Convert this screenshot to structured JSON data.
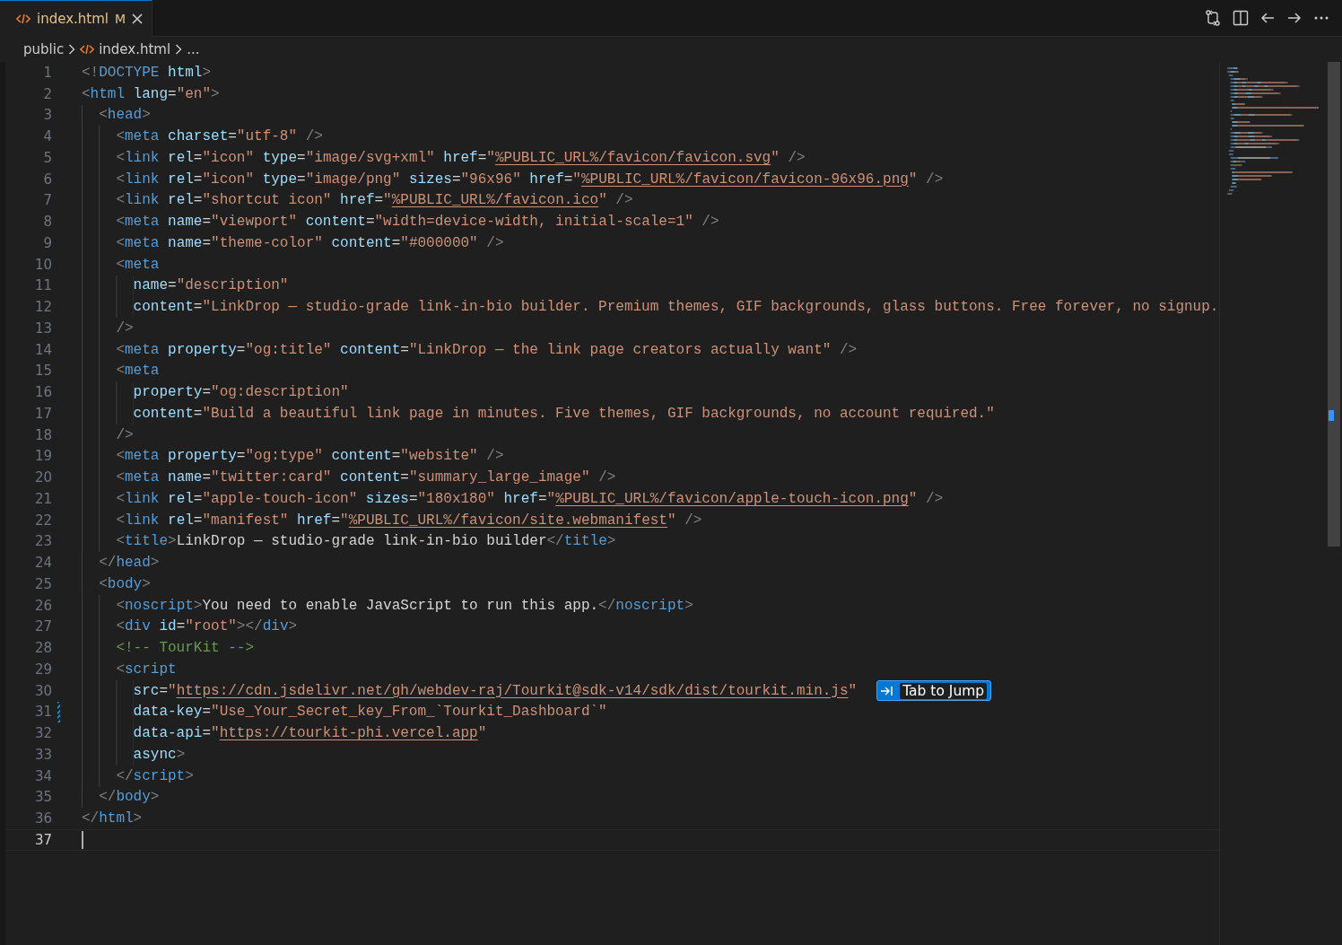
{
  "tabs": [
    {
      "label": "index.html",
      "badge": "M",
      "selected": true
    }
  ],
  "breadcrumbs": [
    "public",
    "index.html",
    "..."
  ],
  "lines": [
    {
      "number": "1",
      "tokens": [
        {
          "kind": "p",
          "text": "<!"
        },
        {
          "kind": "tag",
          "text": "DOCTYPE"
        },
        {
          "kind": "attr",
          "text": " html"
        },
        {
          "kind": "p",
          "text": ">"
        }
      ]
    },
    {
      "number": "2",
      "tokens": [
        {
          "kind": "p",
          "text": "<"
        },
        {
          "kind": "tag",
          "text": "html"
        },
        {
          "kind": "attr",
          "text": " lang"
        },
        {
          "kind": "eq",
          "text": "="
        },
        {
          "kind": "str",
          "text": "\"en\""
        },
        {
          "kind": "p",
          "text": ">"
        }
      ],
      "children": [
        {
          "number": "3",
          "tokens": [
            {
              "kind": "p",
              "text": "<"
            },
            {
              "kind": "tag",
              "text": "head"
            },
            {
              "kind": "p",
              "text": ">"
            }
          ],
          "children": [
            {
              "number": "4",
              "tokens": [
                {
                  "kind": "p",
                  "text": "<"
                },
                {
                  "kind": "tag",
                  "text": "meta"
                },
                {
                  "kind": "attr",
                  "text": " charset"
                },
                {
                  "kind": "eq",
                  "text": "="
                },
                {
                  "kind": "str",
                  "text": "\"utf-8\""
                },
                {
                  "kind": "p",
                  "text": " />"
                }
              ]
            },
            {
              "number": "5",
              "tokens": [
                {
                  "kind": "p",
                  "text": "<"
                },
                {
                  "kind": "tag",
                  "text": "link"
                },
                {
                  "kind": "attr",
                  "text": " rel"
                },
                {
                  "kind": "eq",
                  "text": "="
                },
                {
                  "kind": "str",
                  "text": "\"icon\""
                },
                {
                  "kind": "attr",
                  "text": " type"
                },
                {
                  "kind": "eq",
                  "text": "="
                },
                {
                  "kind": "str",
                  "text": "\"image/svg+xml\""
                },
                {
                  "kind": "attr",
                  "text": " href"
                },
                {
                  "kind": "eq",
                  "text": "="
                },
                {
                  "kind": "str",
                  "text": "\""
                },
                {
                  "kind": "url",
                  "text": "%PUBLIC_URL%/favicon/favicon.svg"
                },
                {
                  "kind": "str",
                  "text": "\""
                },
                {
                  "kind": "p",
                  "text": " />"
                }
              ]
            },
            {
              "number": "6",
              "tokens": [
                {
                  "kind": "p",
                  "text": "<"
                },
                {
                  "kind": "tag",
                  "text": "link"
                },
                {
                  "kind": "attr",
                  "text": " rel"
                },
                {
                  "kind": "eq",
                  "text": "="
                },
                {
                  "kind": "str",
                  "text": "\"icon\""
                },
                {
                  "kind": "attr",
                  "text": " type"
                },
                {
                  "kind": "eq",
                  "text": "="
                },
                {
                  "kind": "str",
                  "text": "\"image/png\""
                },
                {
                  "kind": "attr",
                  "text": " sizes"
                },
                {
                  "kind": "eq",
                  "text": "="
                },
                {
                  "kind": "str",
                  "text": "\"96x96\""
                },
                {
                  "kind": "attr",
                  "text": " href"
                },
                {
                  "kind": "eq",
                  "text": "="
                },
                {
                  "kind": "str",
                  "text": "\""
                },
                {
                  "kind": "url",
                  "text": "%PUBLIC_URL%/favicon/favicon-96x96.png"
                },
                {
                  "kind": "str",
                  "text": "\""
                },
                {
                  "kind": "p",
                  "text": " />"
                }
              ]
            },
            {
              "number": "7",
              "tokens": [
                {
                  "kind": "p",
                  "text": "<"
                },
                {
                  "kind": "tag",
                  "text": "link"
                },
                {
                  "kind": "attr",
                  "text": " rel"
                },
                {
                  "kind": "eq",
                  "text": "="
                },
                {
                  "kind": "str",
                  "text": "\"shortcut icon\""
                },
                {
                  "kind": "attr",
                  "text": " href"
                },
                {
                  "kind": "eq",
                  "text": "="
                },
                {
                  "kind": "str",
                  "text": "\""
                },
                {
                  "kind": "url",
                  "text": "%PUBLIC_URL%/favicon.ico"
                },
                {
                  "kind": "str",
                  "text": "\""
                },
                {
                  "kind": "p",
                  "text": " />"
                }
              ]
            },
            {
              "number": "8",
              "tokens": [
                {
                  "kind": "p",
                  "text": "<"
                },
                {
                  "kind": "tag",
                  "text": "meta"
                },
                {
                  "kind": "attr",
                  "text": " name"
                },
                {
                  "kind": "eq",
                  "text": "="
                },
                {
                  "kind": "str",
                  "text": "\"viewport\""
                },
                {
                  "kind": "attr",
                  "text": " content"
                },
                {
                  "kind": "eq",
                  "text": "="
                },
                {
                  "kind": "str",
                  "text": "\"width=device-width, initial-scale=1\""
                },
                {
                  "kind": "p",
                  "text": " />"
                }
              ]
            },
            {
              "number": "9",
              "tokens": [
                {
                  "kind": "p",
                  "text": "<"
                },
                {
                  "kind": "tag",
                  "text": "meta"
                },
                {
                  "kind": "attr",
                  "text": " name"
                },
                {
                  "kind": "eq",
                  "text": "="
                },
                {
                  "kind": "str",
                  "text": "\"theme-color\""
                },
                {
                  "kind": "attr",
                  "text": " content"
                },
                {
                  "kind": "eq",
                  "text": "="
                },
                {
                  "kind": "str",
                  "text": "\"#000000\""
                },
                {
                  "kind": "p",
                  "text": " />"
                }
              ]
            },
            {
              "number": "10",
              "tokens": [
                {
                  "kind": "p",
                  "text": "<"
                },
                {
                  "kind": "tag",
                  "text": "meta"
                }
              ],
              "children": [
                {
                  "number": "11",
                  "tokens": [
                    {
                      "kind": "attr",
                      "text": "name"
                    },
                    {
                      "kind": "eq",
                      "text": "="
                    },
                    {
                      "kind": "str",
                      "text": "\"description\""
                    }
                  ]
                },
                {
                  "number": "12",
                  "tokens": [
                    {
                      "kind": "attr",
                      "text": "content"
                    },
                    {
                      "kind": "eq",
                      "text": "="
                    },
                    {
                      "kind": "str",
                      "text": "\"LinkDrop — studio-grade link-in-bio builder. Premium themes, GIF backgrounds, glass buttons. Free forever, no signup."
                    }
                  ]
                }
              ]
            },
            {
              "number": "13",
              "tokens": [
                {
                  "kind": "p",
                  "text": "/>"
                }
              ]
            },
            {
              "number": "14",
              "tokens": [
                {
                  "kind": "p",
                  "text": "<"
                },
                {
                  "kind": "tag",
                  "text": "meta"
                },
                {
                  "kind": "attr",
                  "text": " property"
                },
                {
                  "kind": "eq",
                  "text": "="
                },
                {
                  "kind": "str",
                  "text": "\"og:title\""
                },
                {
                  "kind": "attr",
                  "text": " content"
                },
                {
                  "kind": "eq",
                  "text": "="
                },
                {
                  "kind": "str",
                  "text": "\"LinkDrop — the link page creators actually want\""
                },
                {
                  "kind": "p",
                  "text": " />"
                }
              ]
            },
            {
              "number": "15",
              "tokens": [
                {
                  "kind": "p",
                  "text": "<"
                },
                {
                  "kind": "tag",
                  "text": "meta"
                }
              ],
              "children": [
                {
                  "number": "16",
                  "tokens": [
                    {
                      "kind": "attr",
                      "text": "property"
                    },
                    {
                      "kind": "eq",
                      "text": "="
                    },
                    {
                      "kind": "str",
                      "text": "\"og:description\""
                    }
                  ]
                },
                {
                  "number": "17",
                  "tokens": [
                    {
                      "kind": "attr",
                      "text": "content"
                    },
                    {
                      "kind": "eq",
                      "text": "="
                    },
                    {
                      "kind": "str",
                      "text": "\"Build a beautiful link page in minutes. Five themes, GIF backgrounds, no account required.\""
                    }
                  ]
                }
              ]
            },
            {
              "number": "18",
              "tokens": [
                {
                  "kind": "p",
                  "text": "/>"
                }
              ]
            },
            {
              "number": "19",
              "tokens": [
                {
                  "kind": "p",
                  "text": "<"
                },
                {
                  "kind": "tag",
                  "text": "meta"
                },
                {
                  "kind": "attr",
                  "text": " property"
                },
                {
                  "kind": "eq",
                  "text": "="
                },
                {
                  "kind": "str",
                  "text": "\"og:type\""
                },
                {
                  "kind": "attr",
                  "text": " content"
                },
                {
                  "kind": "eq",
                  "text": "="
                },
                {
                  "kind": "str",
                  "text": "\"website\""
                },
                {
                  "kind": "p",
                  "text": " />"
                }
              ]
            },
            {
              "number": "20",
              "tokens": [
                {
                  "kind": "p",
                  "text": "<"
                },
                {
                  "kind": "tag",
                  "text": "meta"
                },
                {
                  "kind": "attr",
                  "text": " name"
                },
                {
                  "kind": "eq",
                  "text": "="
                },
                {
                  "kind": "str",
                  "text": "\"twitter:card\""
                },
                {
                  "kind": "attr",
                  "text": " content"
                },
                {
                  "kind": "eq",
                  "text": "="
                },
                {
                  "kind": "str",
                  "text": "\"summary_large_image\""
                },
                {
                  "kind": "p",
                  "text": " />"
                }
              ]
            },
            {
              "number": "21",
              "tokens": [
                {
                  "kind": "p",
                  "text": "<"
                },
                {
                  "kind": "tag",
                  "text": "link"
                },
                {
                  "kind": "attr",
                  "text": " rel"
                },
                {
                  "kind": "eq",
                  "text": "="
                },
                {
                  "kind": "str",
                  "text": "\"apple-touch-icon\""
                },
                {
                  "kind": "attr",
                  "text": " sizes"
                },
                {
                  "kind": "eq",
                  "text": "="
                },
                {
                  "kind": "str",
                  "text": "\"180x180\""
                },
                {
                  "kind": "attr",
                  "text": " href"
                },
                {
                  "kind": "eq",
                  "text": "="
                },
                {
                  "kind": "str",
                  "text": "\""
                },
                {
                  "kind": "url",
                  "text": "%PUBLIC_URL%/favicon/apple-touch-icon.png"
                },
                {
                  "kind": "str",
                  "text": "\""
                },
                {
                  "kind": "p",
                  "text": " />"
                }
              ]
            },
            {
              "number": "22",
              "tokens": [
                {
                  "kind": "p",
                  "text": "<"
                },
                {
                  "kind": "tag",
                  "text": "link"
                },
                {
                  "kind": "attr",
                  "text": " rel"
                },
                {
                  "kind": "eq",
                  "text": "="
                },
                {
                  "kind": "str",
                  "text": "\"manifest\""
                },
                {
                  "kind": "attr",
                  "text": " href"
                },
                {
                  "kind": "eq",
                  "text": "="
                },
                {
                  "kind": "str",
                  "text": "\""
                },
                {
                  "kind": "url",
                  "text": "%PUBLIC_URL%/favicon/site.webmanifest"
                },
                {
                  "kind": "str",
                  "text": "\""
                },
                {
                  "kind": "p",
                  "text": " />"
                }
              ]
            },
            {
              "number": "23",
              "tokens": [
                {
                  "kind": "p",
                  "text": "<"
                },
                {
                  "kind": "tag",
                  "text": "title"
                },
                {
                  "kind": "p",
                  "text": ">"
                },
                {
                  "kind": "text",
                  "text": "LinkDrop — studio-grade link-in-bio builder"
                },
                {
                  "kind": "p",
                  "text": "</"
                },
                {
                  "kind": "tag",
                  "text": "title"
                },
                {
                  "kind": "p",
                  "text": ">"
                }
              ]
            }
          ]
        },
        {
          "number": "24",
          "tokens": [
            {
              "kind": "p",
              "text": "</"
            },
            {
              "kind": "tag",
              "text": "head"
            },
            {
              "kind": "p",
              "text": ">"
            }
          ]
        },
        {
          "number": "25",
          "tokens": [
            {
              "kind": "p",
              "text": "<"
            },
            {
              "kind": "tag",
              "text": "body"
            },
            {
              "kind": "p",
              "text": ">"
            }
          ],
          "children": [
            {
              "number": "26",
              "tokens": [
                {
                  "kind": "p",
                  "text": "<"
                },
                {
                  "kind": "tag",
                  "text": "noscript"
                },
                {
                  "kind": "p",
                  "text": ">"
                },
                {
                  "kind": "text",
                  "text": "You need to enable JavaScript to run this app."
                },
                {
                  "kind": "p",
                  "text": "</"
                },
                {
                  "kind": "tag",
                  "text": "noscript"
                },
                {
                  "kind": "p",
                  "text": ">"
                }
              ]
            },
            {
              "number": "27",
              "tokens": [
                {
                  "kind": "p",
                  "text": "<"
                },
                {
                  "kind": "tag",
                  "text": "div"
                },
                {
                  "kind": "attr",
                  "text": " id"
                },
                {
                  "kind": "eq",
                  "text": "="
                },
                {
                  "kind": "str",
                  "text": "\"root\""
                },
                {
                  "kind": "p",
                  "text": "></"
                },
                {
                  "kind": "tag",
                  "text": "div"
                },
                {
                  "kind": "p",
                  "text": ">"
                }
              ]
            },
            {
              "number": "28",
              "tokens": [
                {
                  "kind": "comment",
                  "text": "<!-- TourKit -->"
                }
              ]
            },
            {
              "number": "29",
              "tokens": [
                {
                  "kind": "p",
                  "text": "<"
                },
                {
                  "kind": "tag",
                  "text": "script"
                }
              ],
              "children": [
                {
                  "number": "30",
                  "hint": "Tab to Jump",
                  "tokens": [
                    {
                      "kind": "attr",
                      "text": "src"
                    },
                    {
                      "kind": "eq",
                      "text": "="
                    },
                    {
                      "kind": "str",
                      "text": "\""
                    },
                    {
                      "kind": "url",
                      "text": "https://cdn.jsdelivr.net/gh/webdev-raj/Tourkit@sdk-v14/sdk/dist/tourkit.min.js"
                    },
                    {
                      "kind": "str",
                      "text": "\""
                    }
                  ]
                },
                {
                  "number": "31",
                  "modified": true,
                  "tokens": [
                    {
                      "kind": "attr",
                      "text": "data-key"
                    },
                    {
                      "kind": "eq",
                      "text": "="
                    },
                    {
                      "kind": "str",
                      "text": "\"Use_Your_Secret_key_From_`Tourkit_Dashboard`\""
                    }
                  ]
                },
                {
                  "number": "32",
                  "tokens": [
                    {
                      "kind": "attr",
                      "text": "data-api"
                    },
                    {
                      "kind": "eq",
                      "text": "="
                    },
                    {
                      "kind": "str",
                      "text": "\""
                    },
                    {
                      "kind": "url",
                      "text": "https://tourkit-phi.vercel.app"
                    },
                    {
                      "kind": "str",
                      "text": "\""
                    }
                  ]
                },
                {
                  "number": "33",
                  "tokens": [
                    {
                      "kind": "attr",
                      "text": "async"
                    },
                    {
                      "kind": "p",
                      "text": ">"
                    }
                  ]
                }
              ]
            },
            {
              "number": "34",
              "tokens": [
                {
                  "kind": "p",
                  "text": "</"
                },
                {
                  "kind": "tag",
                  "text": "script"
                },
                {
                  "kind": "p",
                  "text": ">"
                }
              ]
            }
          ]
        },
        {
          "number": "35",
          "tokens": [
            {
              "kind": "p",
              "text": "</"
            },
            {
              "kind": "tag",
              "text": "body"
            },
            {
              "kind": "p",
              "text": ">"
            }
          ]
        }
      ]
    },
    {
      "number": "36",
      "tokens": [
        {
          "kind": "p",
          "text": "</"
        },
        {
          "kind": "tag",
          "text": "html"
        },
        {
          "kind": "p",
          "text": ">"
        }
      ]
    },
    {
      "number": "37",
      "current": true
    }
  ]
}
